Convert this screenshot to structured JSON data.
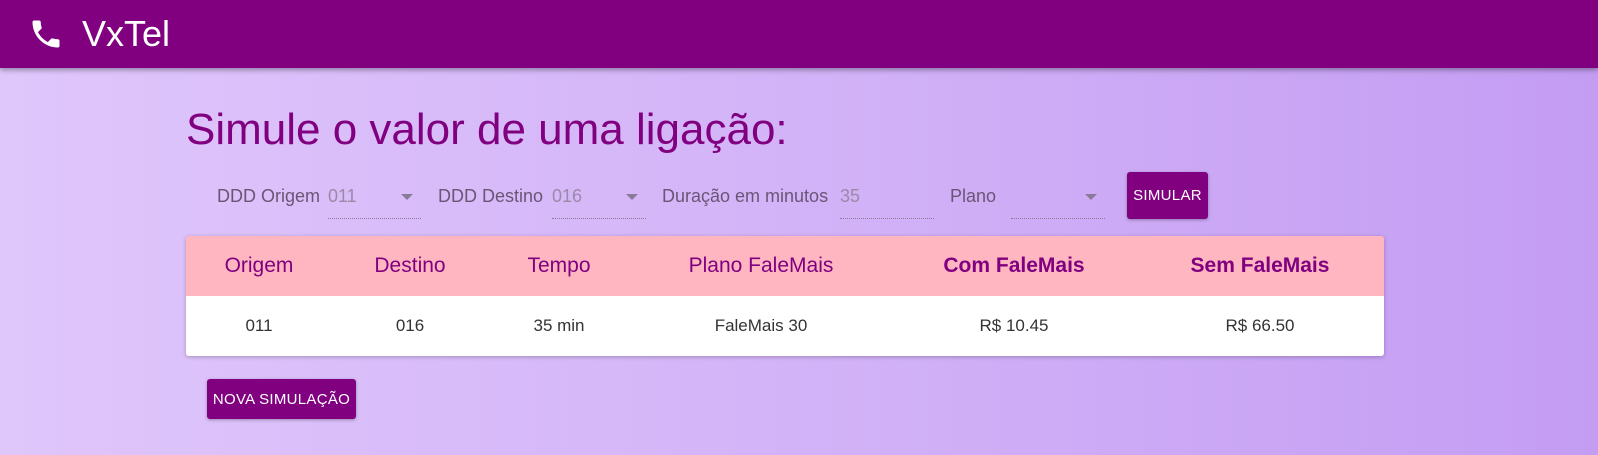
{
  "appbar": {
    "icon": "phone-icon",
    "brand": "VxTel"
  },
  "page": {
    "title": "Simule o valor de uma ligação:"
  },
  "form": {
    "ddd_origem": {
      "label": "DDD Origem",
      "value": "011"
    },
    "ddd_destino": {
      "label": "DDD Destino",
      "value": "016"
    },
    "duracao": {
      "label": "Duração em minutos",
      "value": "35"
    },
    "plano": {
      "label": "Plano",
      "value": ""
    },
    "simular_label": "SIMULAR"
  },
  "table": {
    "headers": [
      "Origem",
      "Destino",
      "Tempo",
      "Plano FaleMais",
      "Com FaleMais",
      "Sem FaleMais"
    ],
    "rows": [
      [
        "011",
        "016",
        "35 min",
        "FaleMais 30",
        "R$ 10.45",
        "R$ 66.50"
      ]
    ]
  },
  "actions": {
    "nova_simulacao_label": "NOVA SIMULAÇÃO"
  },
  "colors": {
    "primary": "#800080",
    "table_header_bg": "#ffb6c1",
    "background": "#d4b5f8"
  }
}
